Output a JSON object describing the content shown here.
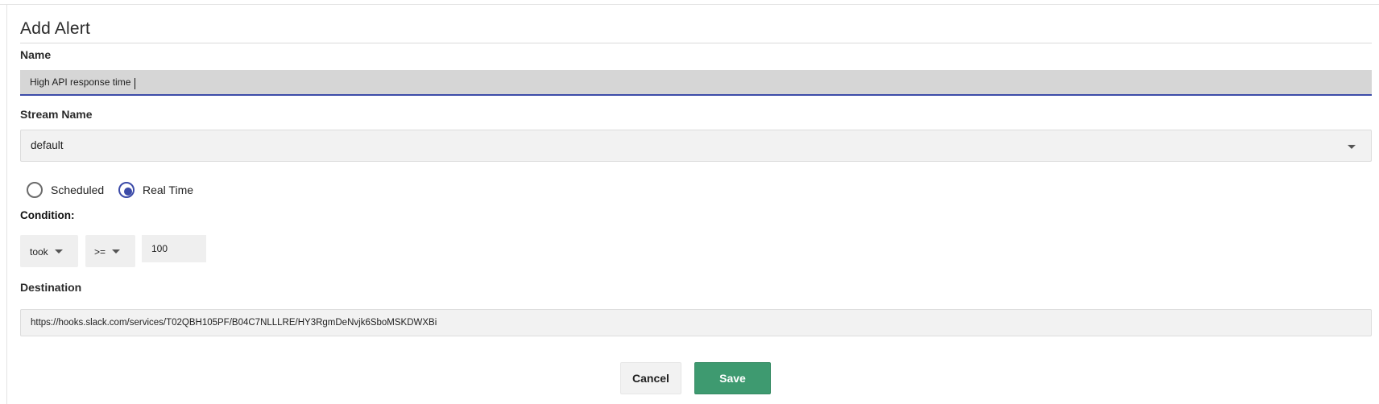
{
  "form": {
    "title": "Add Alert",
    "name_label": "Name",
    "name_value": "High API response time",
    "stream_label": "Stream Name",
    "stream_value": "default",
    "mode_options": [
      {
        "label": "Scheduled",
        "checked": false
      },
      {
        "label": "Real Time",
        "checked": true
      }
    ],
    "condition_label": "Condition:",
    "condition": {
      "field": "took",
      "operator": ">=",
      "value": "100"
    },
    "destination_label": "Destination",
    "destination_value": "https://hooks.slack.com/services/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",
    "cancel_label": "Cancel",
    "save_label": "Save"
  },
  "colors": {
    "accent": "#3c4ba8",
    "save_button": "#3e9a70",
    "field_background": "#f2f2f2",
    "active_input_background": "#d6d6d6"
  },
  "icons": {
    "dropdown": "caret-down-icon"
  }
}
